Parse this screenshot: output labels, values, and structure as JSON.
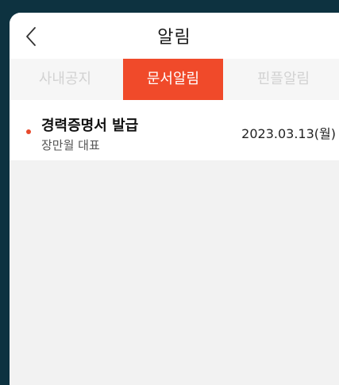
{
  "header": {
    "title": "알림",
    "back_icon": "chevron-left-icon"
  },
  "tabs": [
    {
      "label": "사내공지",
      "active": false
    },
    {
      "label": "문서알림",
      "active": true
    },
    {
      "label": "핀플알림",
      "active": false
    }
  ],
  "notifications": [
    {
      "title": "경력증명서 발급",
      "sender": "장만월 대표",
      "date": "2023.03.13(월)",
      "unread": true
    }
  ],
  "colors": {
    "accent": "#f04a2a",
    "unread_dot": "#e84a2c",
    "frame_background": "#0d3240",
    "list_background": "#f2f2f2"
  }
}
